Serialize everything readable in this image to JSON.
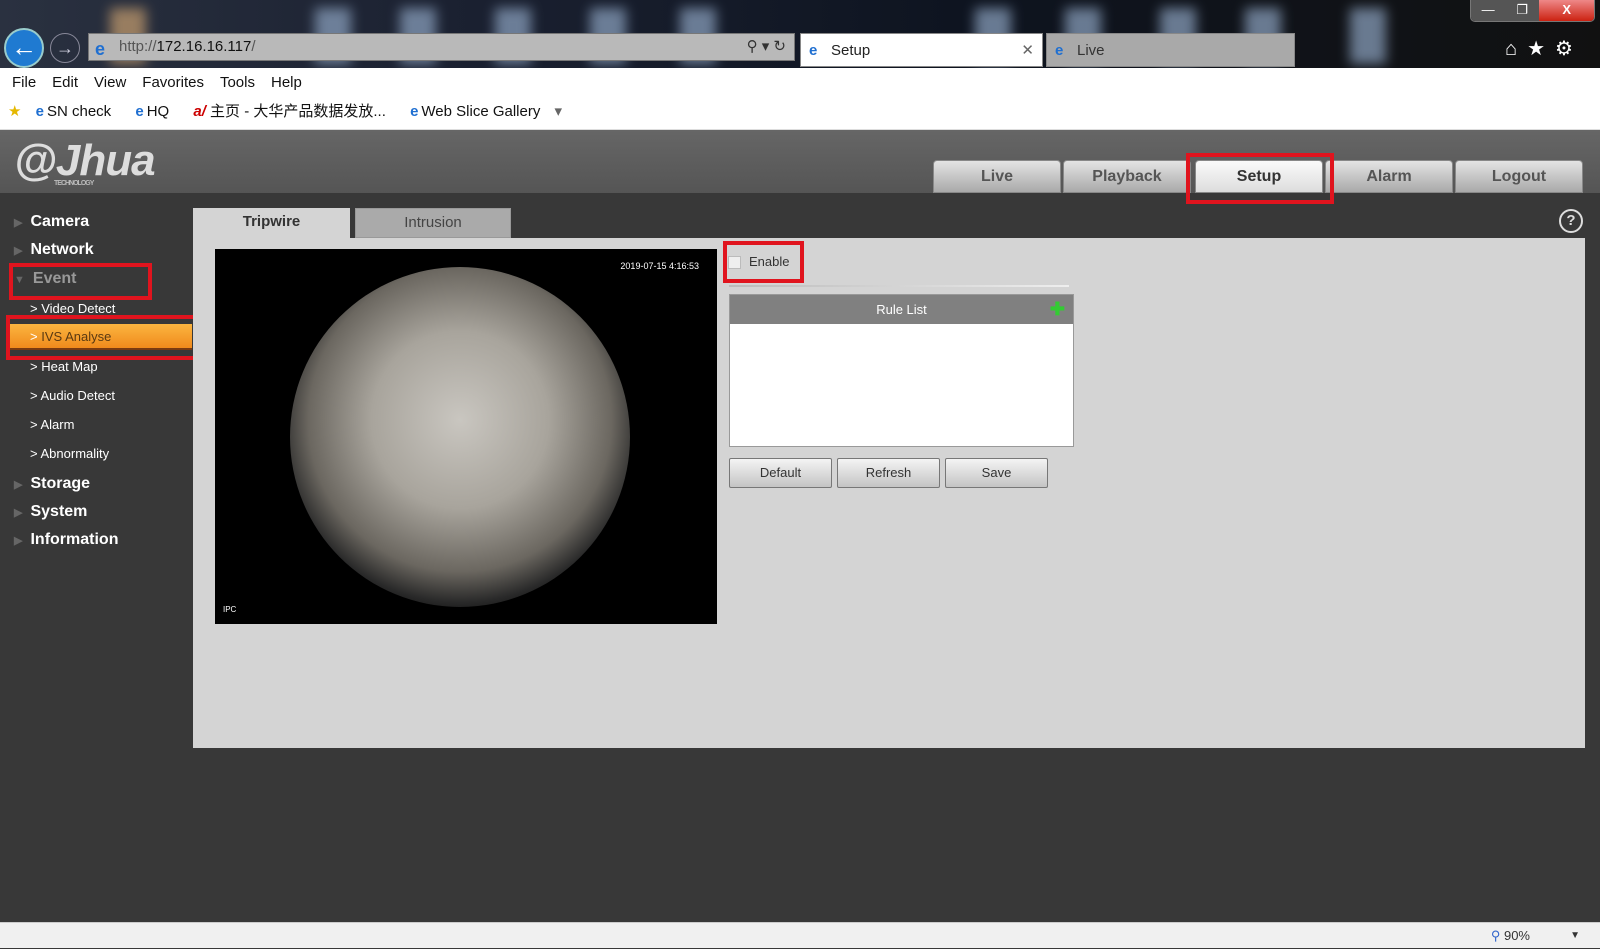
{
  "browser": {
    "url_prefix": "http://",
    "url_host": "172.16.16.117",
    "url_suffix": "/",
    "tabs": [
      {
        "label": "Setup",
        "active": true
      },
      {
        "label": "Live",
        "active": false
      }
    ],
    "menu": [
      "File",
      "Edit",
      "View",
      "Favorites",
      "Tools",
      "Help"
    ],
    "favorites": [
      "SN check",
      "HQ",
      "主页 - 大华产品数据发放...",
      "Web Slice Gallery"
    ],
    "zoom": "90%"
  },
  "app": {
    "logo": "alhua",
    "logo_sub": "TECHNOLOGY",
    "nav": [
      {
        "label": "Live"
      },
      {
        "label": "Playback"
      },
      {
        "label": "Setup",
        "active": true
      },
      {
        "label": "Alarm"
      },
      {
        "label": "Logout"
      }
    ],
    "sidebar": {
      "main": [
        "Camera",
        "Network",
        "Event",
        "Storage",
        "System",
        "Information"
      ],
      "event_sub": [
        "Video Detect",
        "IVS Analyse",
        "Heat Map",
        "Audio Detect",
        "Alarm",
        "Abnormality"
      ],
      "active": "IVS Analyse"
    },
    "tabs": [
      {
        "label": "Tripwire",
        "active": true
      },
      {
        "label": "Intrusion"
      }
    ],
    "video": {
      "timestamp": "2019-07-15  4:16:53",
      "channel": "IPC"
    },
    "enable_label": "Enable",
    "enable_checked": false,
    "rule_list_title": "Rule List",
    "buttons": {
      "default": "Default",
      "refresh": "Refresh",
      "save": "Save"
    },
    "highlight_color": "#e0141e",
    "accent_color": "#f5a030"
  }
}
